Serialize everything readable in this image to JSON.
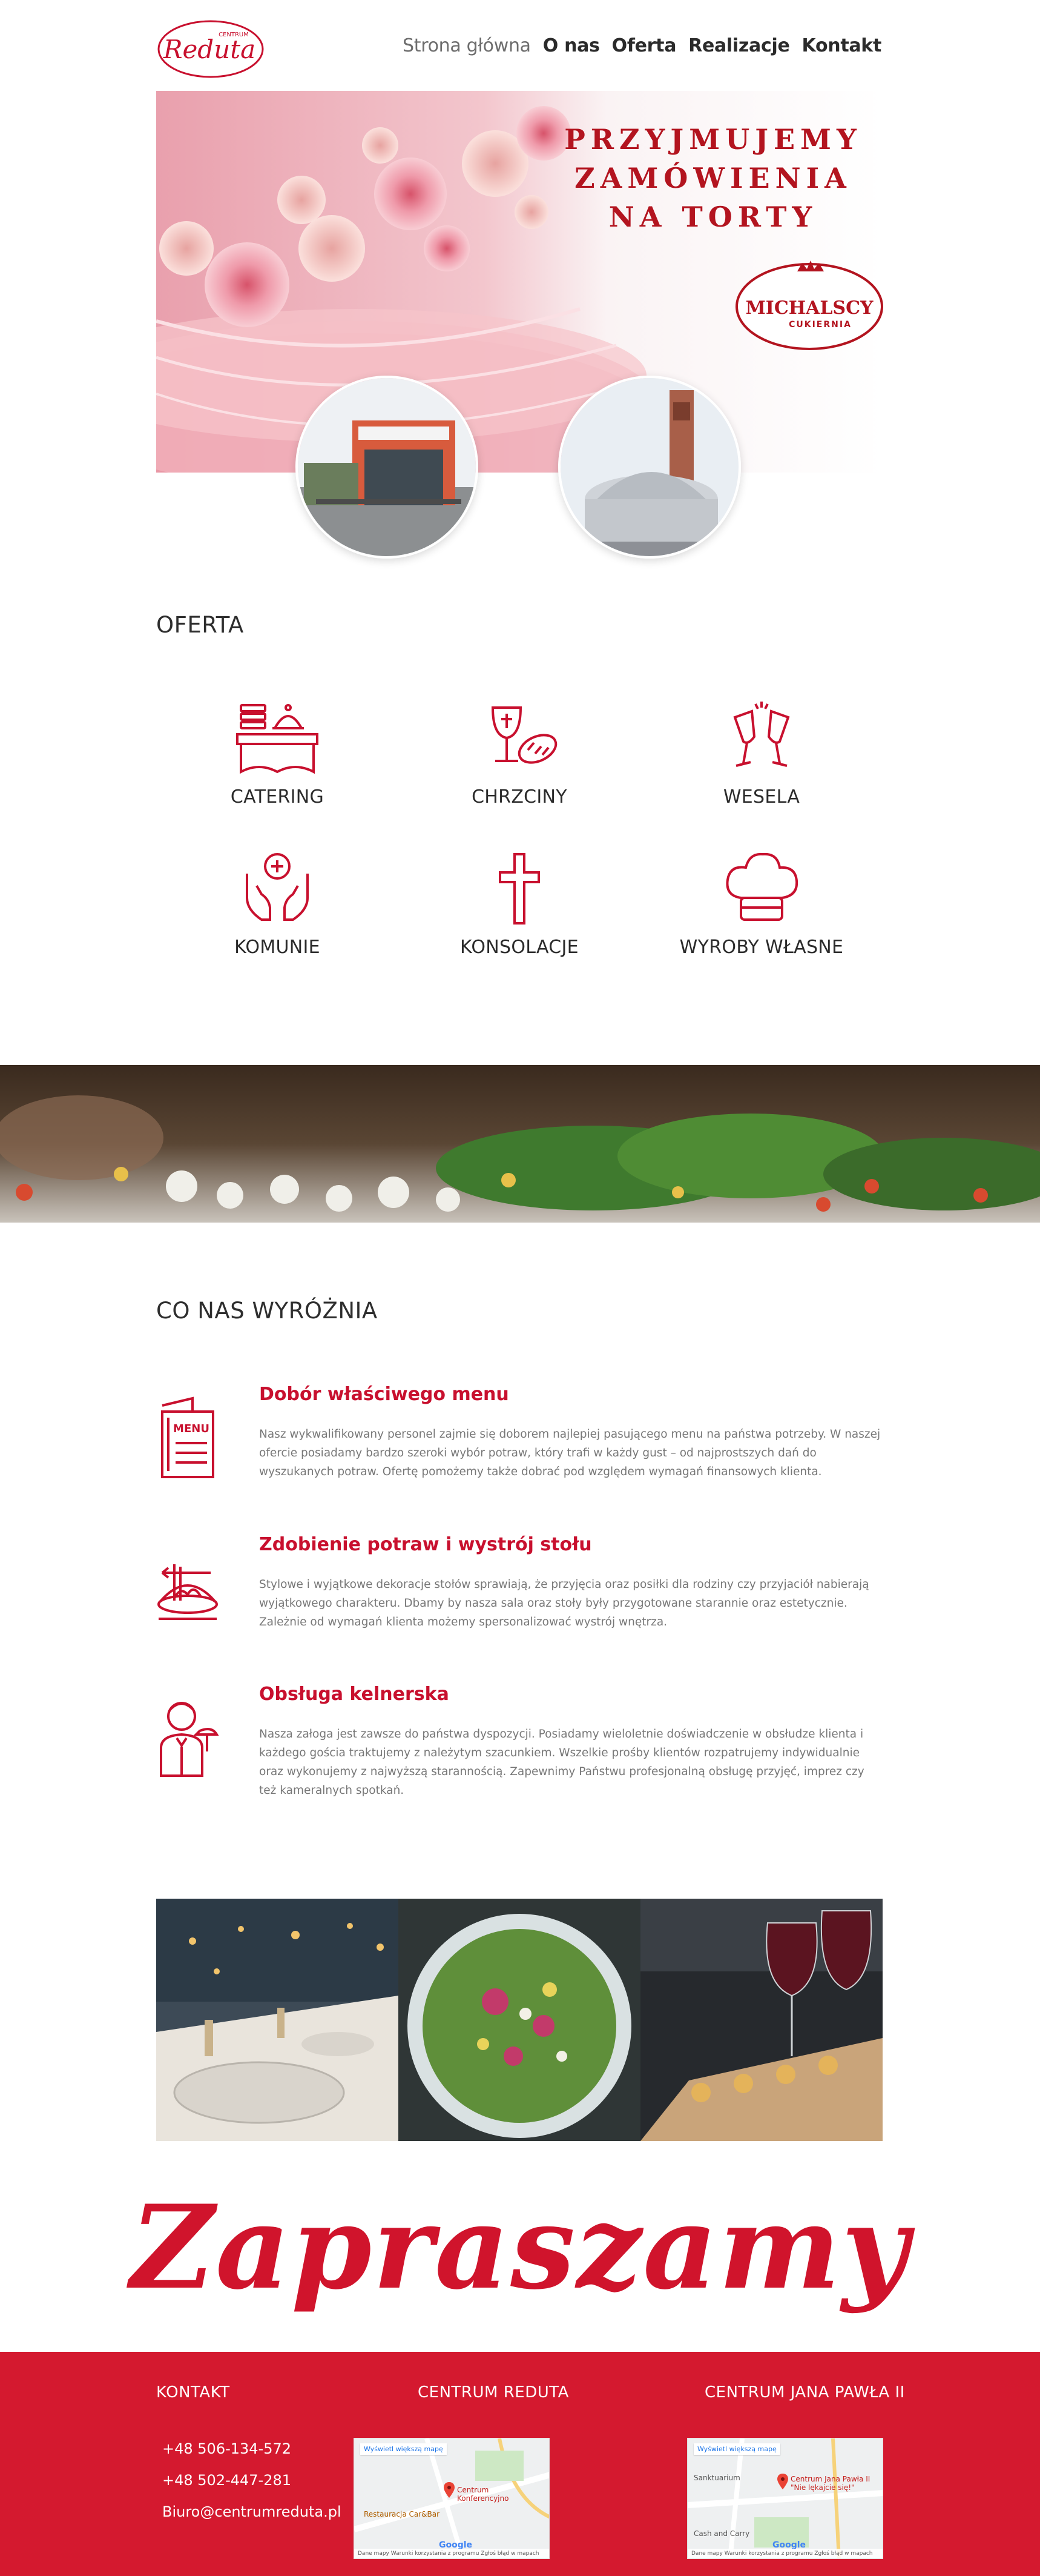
{
  "brand": {
    "logo_small": "CENTRUM",
    "logo_main": "Reduta",
    "accent_color": "#c8102e"
  },
  "nav": {
    "items": [
      {
        "label": "Strona główna",
        "state": "inactive"
      },
      {
        "label": "O nas",
        "state": "active"
      },
      {
        "label": "Oferta",
        "state": "active"
      },
      {
        "label": "Realizacje",
        "state": "active"
      },
      {
        "label": "Kontakt",
        "state": "active"
      }
    ]
  },
  "hero": {
    "title_lines": [
      "PRZYJMUJEMY",
      "ZAMÓWIENIA",
      "NA TORTY"
    ],
    "badge_main": "MICHALSCY",
    "badge_sub": "CUKIERNIA"
  },
  "offer": {
    "heading": "OFERTA",
    "items": [
      {
        "label": "CATERING",
        "icon": "catering-icon"
      },
      {
        "label": "CHRZCINY",
        "icon": "chalice-bread-icon"
      },
      {
        "label": "WESELA",
        "icon": "champagne-glasses-icon"
      },
      {
        "label": "KOMUNIE",
        "icon": "praying-hands-icon"
      },
      {
        "label": "KONSOLACJE",
        "icon": "cross-icon"
      },
      {
        "label": "WYROBY WŁASNE",
        "icon": "chef-hat-icon"
      }
    ]
  },
  "features": {
    "heading": "CO NAS WYRÓŻNIA",
    "items": [
      {
        "title": "Dobór właściwego menu",
        "icon": "menu-card-icon",
        "icon_label": "MENU",
        "text": "Nasz wykwalifikowany personel zajmie się doborem najlepiej pasującego menu na państwa potrzeby. W naszej ofercie posiadamy bardzo szeroki wybór potraw, który trafi w każdy gust – od najprostszych dań do wyszukanych potraw. Ofertę pomożemy także dobrać pod względem wymagań finansowych klienta."
      },
      {
        "title": "Zdobienie potraw i wystrój stołu",
        "icon": "plate-fork-icon",
        "text": "Stylowe i wyjątkowe dekoracje stołów sprawiają, że przyjęcia oraz posiłki dla rodziny czy przyjaciół nabierają wyjątkowego charakteru. Dbamy by nasza sala oraz stoły były przygotowane starannie oraz estetycznie. Zależnie od wymagań klienta możemy spersonalizować wystrój wnętrza."
      },
      {
        "title": "Obsługa kelnerska",
        "icon": "waiter-icon",
        "text": "Nasza załoga jest zawsze do państwa dyspozycji. Posiadamy wieloletnie doświadczenie w obsłudze klienta i każdego gościa traktujemy z należytym szacunkiem. Wszelkie prośby klientów rozpatrujemy indywidualnie oraz wykonujemy z najwyższą starannością. Zapewnimy Państwu profesjonalną obsługę przyjęć, imprez czy też kameralnych spotkań."
      }
    ]
  },
  "invite": {
    "text": "Zapraszamy"
  },
  "footer": {
    "contact_title": "KONTAKT",
    "phone1": "+48 506-134-572",
    "phone2": "+48 502-447-281",
    "email": "Biuro@centrumreduta.pl",
    "col2_title": "CENTRUM REDUTA",
    "col3_title": "CENTRUM JANA PAWŁA II",
    "map_link": "Wyświetl większą mapę",
    "map1_place": "Centrum Konferencyjno",
    "map1_side": "Restauracja Car&Bar",
    "map2_place": "Centrum Jana Pawła II \"Nie lękajcie się!\"",
    "map2_side": "Sanktuarium",
    "map2_shop": "Cash and Carry",
    "map_google": "Google",
    "map_footer": "Dane mapy   Warunki korzystania z programu   Zgłoś błąd w mapach",
    "bg_color": "#d4192f"
  }
}
